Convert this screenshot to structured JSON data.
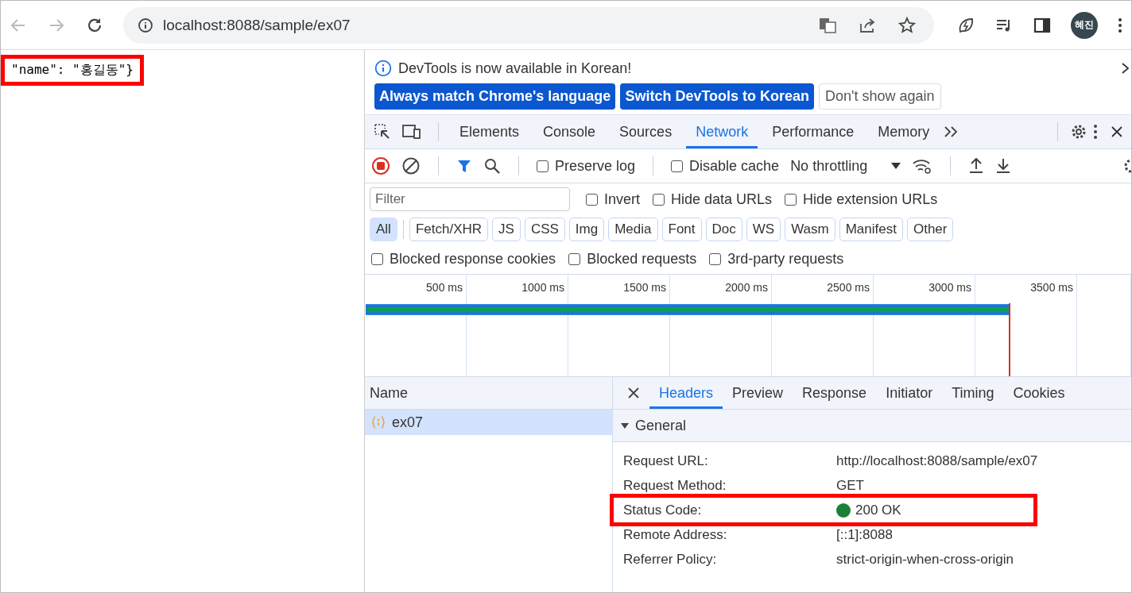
{
  "browser": {
    "url": "localhost:8088/sample/ex07",
    "avatar": "혜진"
  },
  "page": {
    "body": "\"name\": \"홍길동\"}",
    "highlighted": true
  },
  "devtools": {
    "infobar": {
      "message": "DevTools is now available in Korean!",
      "buttons": [
        {
          "label": "Always match Chrome's language",
          "kind": "primary"
        },
        {
          "label": "Switch DevTools to Korean",
          "kind": "primary"
        },
        {
          "label": "Don't show again",
          "kind": "plain"
        }
      ]
    },
    "tabs": [
      {
        "label": "Elements",
        "selected": false
      },
      {
        "label": "Console",
        "selected": false
      },
      {
        "label": "Sources",
        "selected": false
      },
      {
        "label": "Network",
        "selected": true
      },
      {
        "label": "Performance",
        "selected": false
      },
      {
        "label": "Memory",
        "selected": false
      }
    ],
    "toolbar": {
      "checks": [
        {
          "label": "Preserve log",
          "checked": false
        },
        {
          "label": "Disable cache",
          "checked": false
        }
      ],
      "throttling": "No throttling"
    },
    "filter": {
      "placeholder": "Filter",
      "checks": [
        {
          "label": "Invert",
          "checked": false
        },
        {
          "label": "Hide data URLs",
          "checked": false
        },
        {
          "label": "Hide extension URLs",
          "checked": false
        }
      ]
    },
    "types": [
      {
        "label": "All",
        "selected": true
      },
      {
        "label": "Fetch/XHR",
        "selected": false
      },
      {
        "label": "JS",
        "selected": false
      },
      {
        "label": "CSS",
        "selected": false
      },
      {
        "label": "Img",
        "selected": false
      },
      {
        "label": "Media",
        "selected": false
      },
      {
        "label": "Font",
        "selected": false
      },
      {
        "label": "Doc",
        "selected": false
      },
      {
        "label": "WS",
        "selected": false
      },
      {
        "label": "Wasm",
        "selected": false
      },
      {
        "label": "Manifest",
        "selected": false
      },
      {
        "label": "Other",
        "selected": false
      }
    ],
    "more_checks": [
      {
        "label": "Blocked response cookies",
        "checked": false
      },
      {
        "label": "Blocked requests",
        "checked": false
      },
      {
        "label": "3rd-party requests",
        "checked": false
      }
    ],
    "timeline": {
      "ticks": [
        "500 ms",
        "1000 ms",
        "1500 ms",
        "2000 ms",
        "2500 ms",
        "3000 ms",
        "3500 ms"
      ]
    },
    "requests": {
      "column": "Name",
      "rows": [
        {
          "name": "ex07",
          "selected": true
        }
      ]
    },
    "detail_tabs": [
      {
        "label": "Headers",
        "selected": true
      },
      {
        "label": "Preview",
        "selected": false
      },
      {
        "label": "Response",
        "selected": false
      },
      {
        "label": "Initiator",
        "selected": false
      },
      {
        "label": "Timing",
        "selected": false
      },
      {
        "label": "Cookies",
        "selected": false
      }
    ],
    "general": {
      "title": "General",
      "expanded": true,
      "rows": [
        {
          "key": "Request URL:",
          "value": "http://localhost:8088/sample/ex07",
          "highlighted": false
        },
        {
          "key": "Request Method:",
          "value": "GET",
          "highlighted": false
        },
        {
          "key": "Status Code:",
          "value": "200 OK",
          "highlighted": true,
          "color": "#188038"
        },
        {
          "key": "Remote Address:",
          "value": "[::1]:8088",
          "highlighted": false
        },
        {
          "key": "Referrer Policy:",
          "value": "strict-origin-when-cross-origin",
          "highlighted": false
        }
      ]
    }
  }
}
